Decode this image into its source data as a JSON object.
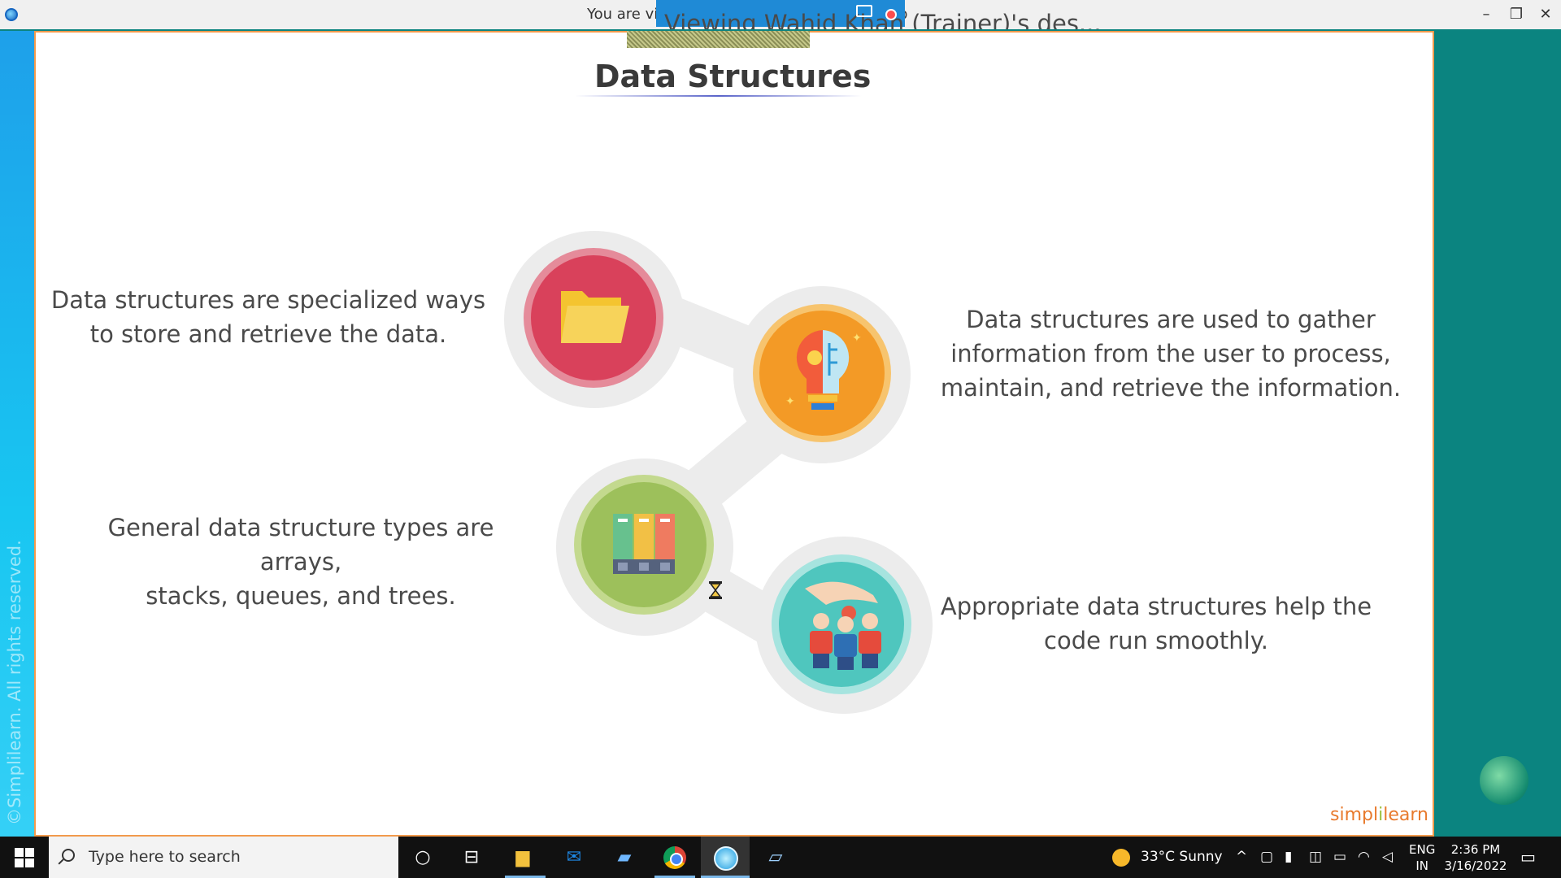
{
  "window": {
    "title_prefix": "You are vie",
    "title_suffix": "p",
    "share_banner": "Viewing Wahid Khan (Trainer)'s des..."
  },
  "slide": {
    "title": "Data Structures",
    "copyright": "©Simplilearn. All rights reserved.",
    "points": [
      {
        "lines": [
          "Data structures are specialized ways",
          "to store and retrieve the data."
        ]
      },
      {
        "lines": [
          "Data structures are used to gather",
          "information from the user to process,",
          "maintain, and retrieve the information."
        ]
      },
      {
        "lines": [
          "General data structure types are arrays,",
          "stacks, queues, and trees."
        ]
      },
      {
        "lines": [
          "Appropriate data structures help the",
          "code run smoothly."
        ]
      }
    ],
    "logo": {
      "a": "simpl",
      "sep": "i",
      "b": "learn"
    },
    "colors": {
      "red": "#d9415b",
      "orange": "#f39a26",
      "green": "#9dc05b",
      "teal": "#4fc6be"
    }
  },
  "taskbar": {
    "search_placeholder": "Type here to search",
    "apps": [
      "cortana-icon",
      "task-view-icon",
      "file-explorer-icon",
      "mail-icon",
      "laptop-icon",
      "chrome-icon",
      "meeting-app-icon",
      "notes-app-icon"
    ],
    "weather": "33°C  Sunny",
    "lang_top": "ENG",
    "lang_bottom": "IN",
    "time": "2:36 PM",
    "date": "3/16/2022"
  }
}
